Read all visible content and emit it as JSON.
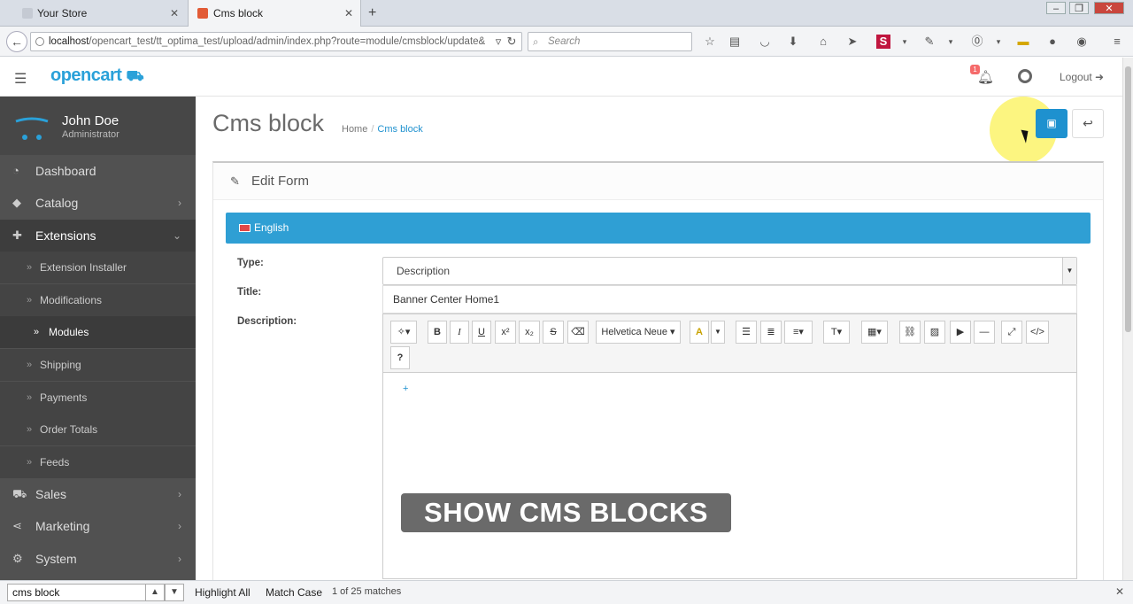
{
  "browser": {
    "tabs": [
      {
        "label": "Your Store",
        "active": false
      },
      {
        "label": "Cms block",
        "active": true
      }
    ],
    "url_host": "localhost",
    "url_path": "/opencart_test/tt_optima_test/upload/admin/index.php?route=module/cmsblock/update&",
    "search_placeholder": "Search",
    "new_tab": "+",
    "close_glyph": "✕"
  },
  "header": {
    "logo": "opencart",
    "notification_count": "1",
    "logout_label": "Logout"
  },
  "sidebar": {
    "user_name": "John Doe",
    "user_role": "Administrator",
    "items": [
      {
        "label": "Dashboard",
        "icon": "dashboard-icon"
      },
      {
        "label": "Catalog",
        "icon": "tag-icon"
      },
      {
        "label": "Extensions",
        "icon": "puzzle-icon"
      },
      {
        "label": "Sales",
        "icon": "cart-icon"
      },
      {
        "label": "Marketing",
        "icon": "share-icon"
      },
      {
        "label": "System",
        "icon": "cog-icon"
      }
    ],
    "sub_items": [
      {
        "label": "Extension Installer"
      },
      {
        "label": "Modifications"
      },
      {
        "label": "Modules"
      },
      {
        "label": "Shipping"
      },
      {
        "label": "Payments"
      },
      {
        "label": "Order Totals"
      },
      {
        "label": "Feeds"
      }
    ]
  },
  "main": {
    "page_title": "Cms block",
    "breadcrumb": {
      "home": "Home",
      "current": "Cms block"
    },
    "panel_title": "Edit Form",
    "language": "English",
    "form": {
      "type_label": "Type:",
      "type_value": "Description",
      "title_label": "Title:",
      "title_value": "Banner Center Home1",
      "description_label": "Description:"
    },
    "editor_toolbar": {
      "font_name": "Helvetica Neue",
      "help": "?"
    },
    "overlay_caption": "SHOW CMS BLOCKS"
  },
  "findbar": {
    "query": "cms block",
    "highlight_all": "Highlight All",
    "match_case": "Match Case",
    "status": "1 of 25 matches"
  },
  "colors": {
    "accent": "#1e91cf",
    "sidebar": "#515151",
    "language_bar": "#2f9fd4"
  }
}
